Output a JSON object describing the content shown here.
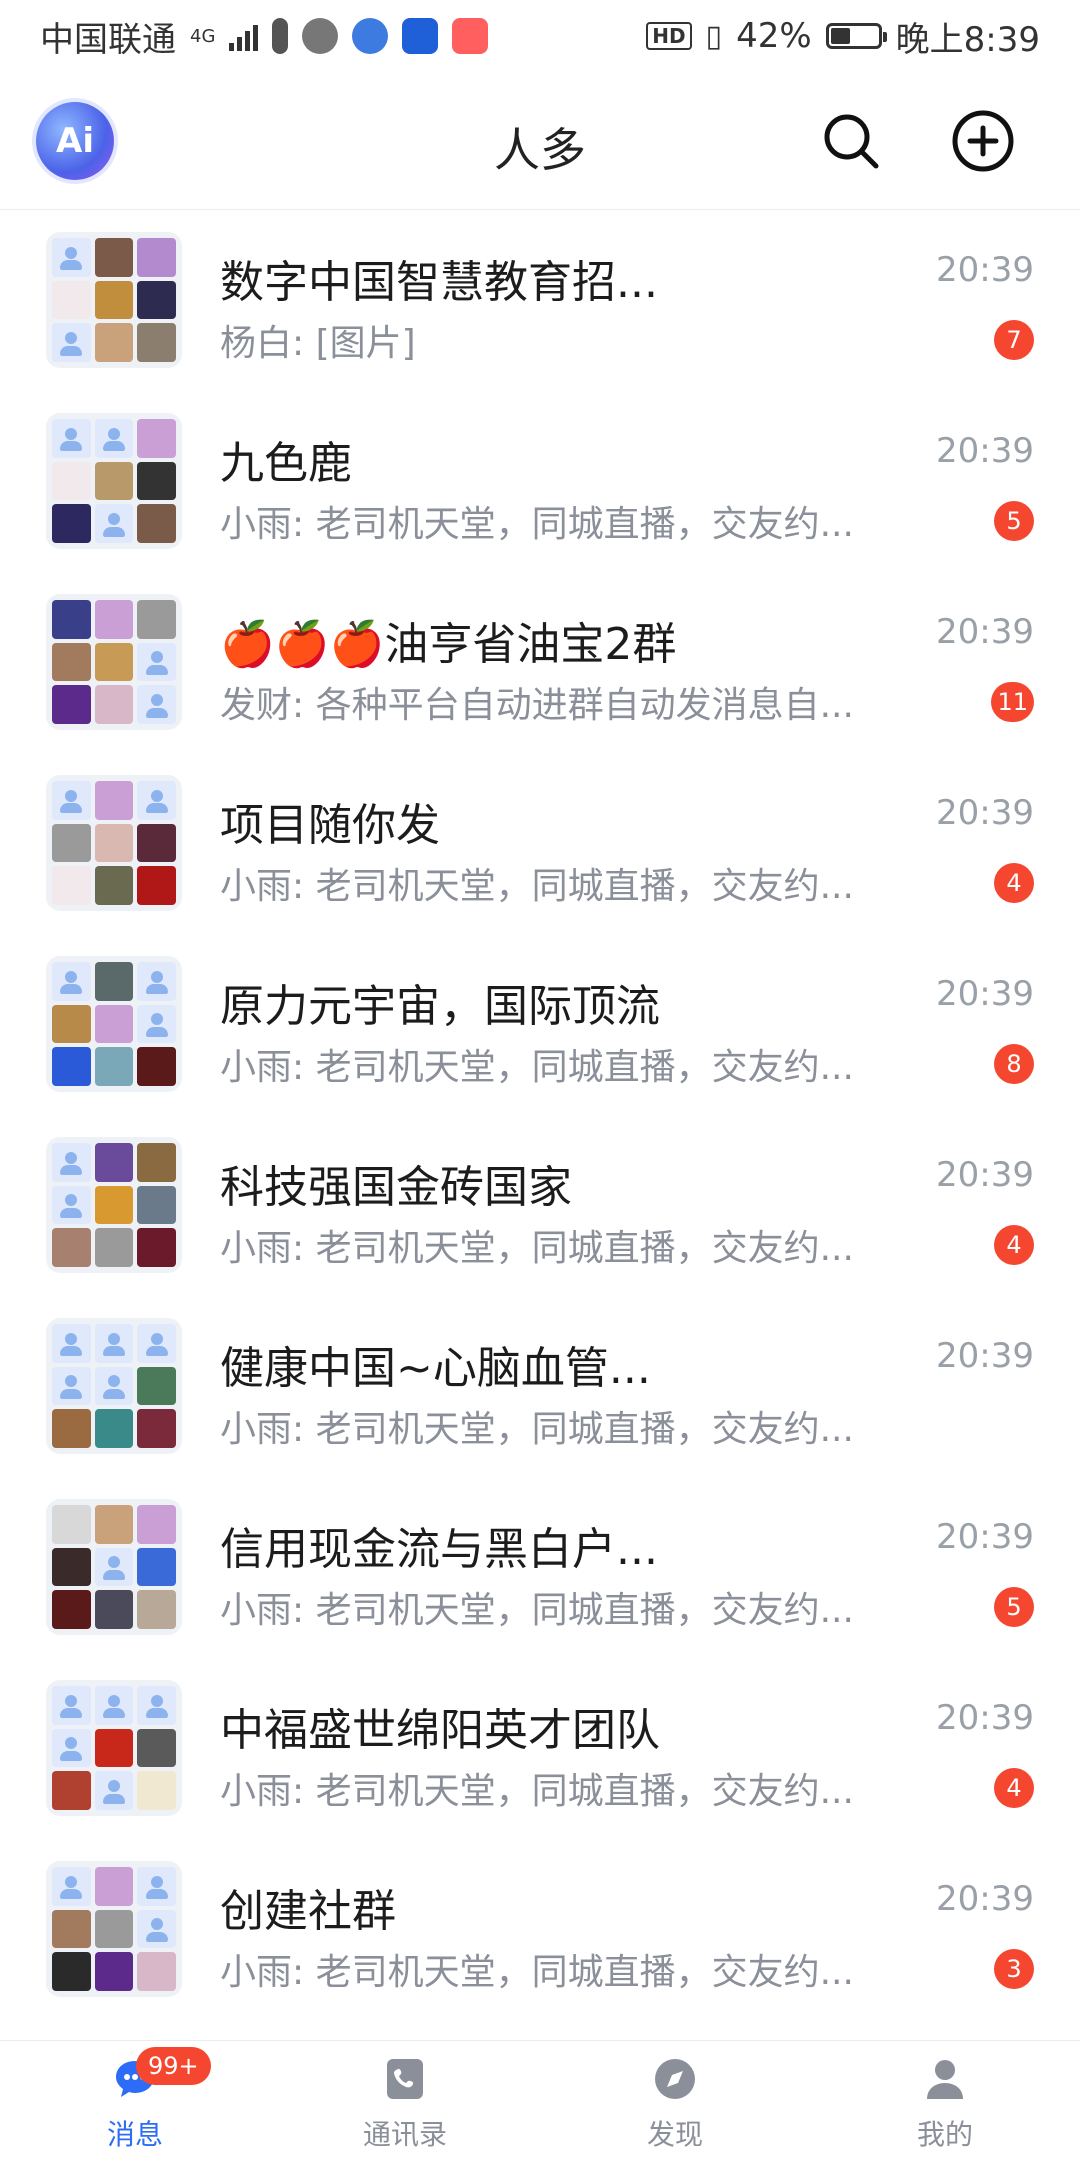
{
  "status_bar": {
    "carrier": "中国联通",
    "network": "4G",
    "hd": "HD",
    "battery_percent_text": "42%",
    "battery_level": 0.42,
    "time": "晚上8:39"
  },
  "header": {
    "ai_label": "Ai",
    "title": "人多"
  },
  "chats": [
    {
      "name": "数字中国智慧教育招...",
      "preview": "杨白: [图片]",
      "time": "20:39",
      "unread": "7"
    },
    {
      "name": "九色鹿",
      "preview": "小雨: 老司机天堂，同城直播，交友约...",
      "time": "20:39",
      "unread": "5"
    },
    {
      "name": "🍎🍎🍎油亨省油宝2群",
      "preview": "发财: 各种平台自动进群自动发消息自...",
      "time": "20:39",
      "unread": "11"
    },
    {
      "name": "项目随你发",
      "preview": "小雨: 老司机天堂，同城直播，交友约...",
      "time": "20:39",
      "unread": "4"
    },
    {
      "name": "原力元宇宙，国际顶流",
      "preview": "小雨: 老司机天堂，同城直播，交友约...",
      "time": "20:39",
      "unread": "8"
    },
    {
      "name": "科技强国金砖国家",
      "preview": "小雨: 老司机天堂，同城直播，交友约...",
      "time": "20:39",
      "unread": "4"
    },
    {
      "name": "健康中国~心脑血管...",
      "preview": "小雨: 老司机天堂，同城直播，交友约...",
      "time": "20:39",
      "unread": ""
    },
    {
      "name": "信用现金流与黑白户...",
      "preview": "小雨: 老司机天堂，同城直播，交友约...",
      "time": "20:39",
      "unread": "5"
    },
    {
      "name": "中福盛世绵阳英才团队",
      "preview": "小雨: 老司机天堂，同城直播，交友约...",
      "time": "20:39",
      "unread": "4"
    },
    {
      "name": "创建社群",
      "preview": "小雨: 老司机天堂，同城直播，交友约...",
      "time": "20:39",
      "unread": "3"
    }
  ],
  "bottom_nav": {
    "messages": {
      "label": "消息",
      "badge": "99+"
    },
    "contacts": {
      "label": "通讯录"
    },
    "discover": {
      "label": "发现"
    },
    "me": {
      "label": "我的"
    }
  },
  "colors": {
    "accent": "#2d6cf6",
    "badge": "#f5462f",
    "muted": "#8a8f99"
  }
}
